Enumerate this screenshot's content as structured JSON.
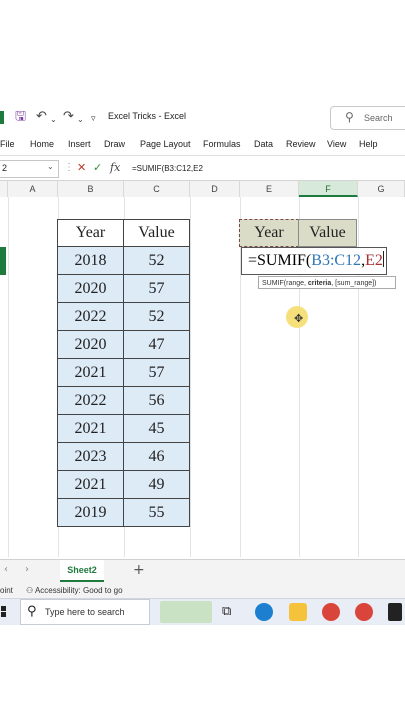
{
  "app": {
    "title": "Excel Tricks  -  Excel",
    "search": "Search"
  },
  "ribbon": {
    "tabs": [
      "File",
      "Home",
      "Insert",
      "Draw",
      "Page Layout",
      "Formulas",
      "Data",
      "Review",
      "View",
      "Help"
    ]
  },
  "formula_bar": {
    "name_box": "2",
    "formula": "=SUMIF(B3:C12,E2"
  },
  "columns": [
    "A",
    "B",
    "C",
    "D",
    "E",
    "F",
    "G"
  ],
  "table": {
    "headers": [
      "Year",
      "Value"
    ],
    "rows": [
      [
        "2018",
        "52"
      ],
      [
        "2020",
        "57"
      ],
      [
        "2022",
        "52"
      ],
      [
        "2020",
        "47"
      ],
      [
        "2021",
        "57"
      ],
      [
        "2022",
        "56"
      ],
      [
        "2021",
        "45"
      ],
      [
        "2023",
        "46"
      ],
      [
        "2021",
        "49"
      ],
      [
        "2019",
        "55"
      ]
    ]
  },
  "criteria": {
    "headers": [
      "Year",
      "Value"
    ]
  },
  "formula_cell": {
    "prefix": "=SUMIF(",
    "range": "B3:C12",
    "sep": ",",
    "criteria": "E2"
  },
  "tooltip": {
    "fn": "SUMIF(range, ",
    "active": "criteria",
    "rest": ", [sum_range])"
  },
  "sheet": {
    "tab": "Sheet2"
  },
  "status": {
    "mode": "oint",
    "accessibility": "Accessibility: Good to go"
  },
  "taskbar": {
    "search": "Type here to search"
  },
  "colors": {
    "accent": "#1f7a3e",
    "table_fill": "#ddebf7",
    "criteria_fill": "#dadcc7",
    "ref_blue": "#2e75b6",
    "ref_red": "#a33232"
  }
}
